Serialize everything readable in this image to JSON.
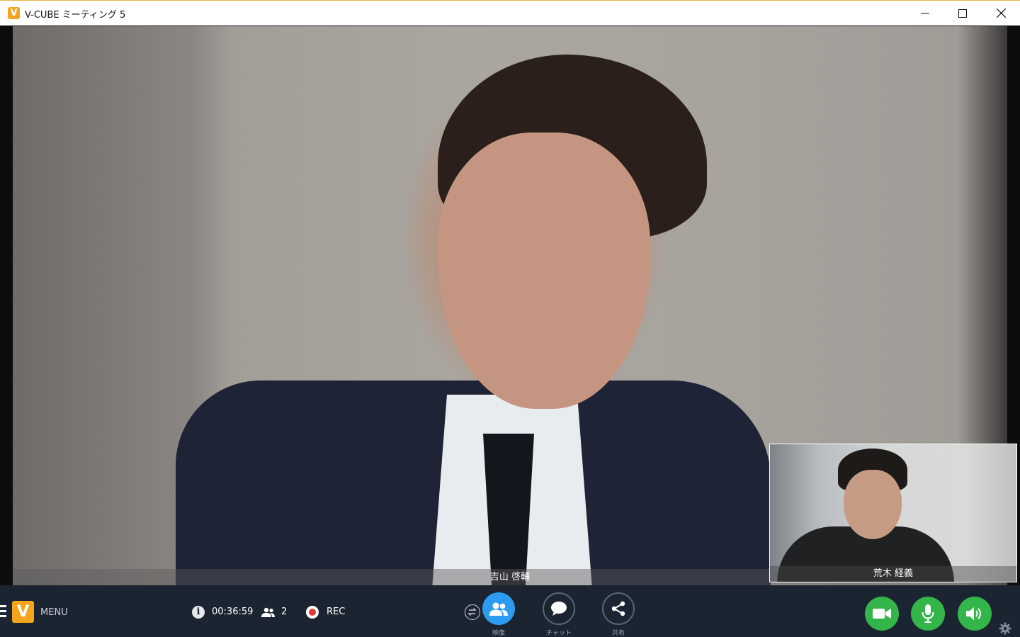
{
  "window": {
    "app_icon": "V",
    "title": "V-CUBE ミーティング 5",
    "controls": [
      "minimize-icon",
      "maximize-icon",
      "close-icon"
    ]
  },
  "videos": {
    "main_participant": "吉山 啓輔",
    "self_participant": "荒木 経義"
  },
  "toolbar": {
    "logo_letter": "V",
    "menu_label": "MENU",
    "elapsed_time": "00:36:59",
    "participant_count": "2",
    "rec_label": "REC",
    "buttons": [
      {
        "label": "映像",
        "icon": "people-icon",
        "active": true
      },
      {
        "label": "チャット",
        "icon": "chat-bubble-icon",
        "active": false
      },
      {
        "label": "共有",
        "icon": "share-icon",
        "active": false
      }
    ],
    "device_buttons": [
      "camera-icon",
      "microphone-icon",
      "speaker-icon"
    ],
    "accent_color": "#2d9cf0",
    "device_color": "#33b54a",
    "rec_color": "#e53935"
  }
}
